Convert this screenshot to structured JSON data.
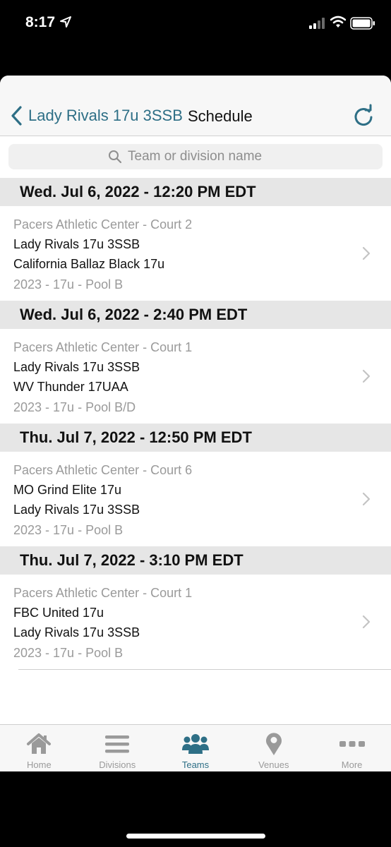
{
  "status_bar": {
    "time": "8:17"
  },
  "nav": {
    "back_label": "Lady Rivals 17u 3SSB",
    "title": "Schedule"
  },
  "search": {
    "placeholder": "Team or division name"
  },
  "games": [
    {
      "datetime": "Wed. Jul 6, 2022 - 12:20 PM EDT",
      "venue": "Pacers Athletic Center - Court 2",
      "team1": "Lady Rivals 17u 3SSB",
      "team2": "California Ballaz Black 17u",
      "division": "2023 - 17u - Pool B"
    },
    {
      "datetime": "Wed. Jul 6, 2022 - 2:40 PM EDT",
      "venue": "Pacers Athletic Center - Court 1",
      "team1": "Lady Rivals 17u 3SSB",
      "team2": "WV Thunder 17UAA",
      "division": "2023 - 17u - Pool B/D"
    },
    {
      "datetime": "Thu. Jul 7, 2022 - 12:50 PM EDT",
      "venue": "Pacers Athletic Center - Court 6",
      "team1": "MO Grind Elite 17u",
      "team2": "Lady Rivals 17u 3SSB",
      "division": "2023 - 17u - Pool B"
    },
    {
      "datetime": "Thu. Jul 7, 2022 - 3:10 PM EDT",
      "venue": "Pacers Athletic Center - Court 1",
      "team1": "FBC United 17u",
      "team2": "Lady Rivals 17u 3SSB",
      "division": "2023 - 17u - Pool B"
    }
  ],
  "tabbar": {
    "tabs": [
      {
        "label": "Home",
        "icon": "home-icon",
        "active": false
      },
      {
        "label": "Divisions",
        "icon": "list-icon",
        "active": false
      },
      {
        "label": "Teams",
        "icon": "teams-icon",
        "active": true
      },
      {
        "label": "Venues",
        "icon": "map-pin-icon",
        "active": false
      },
      {
        "label": "More",
        "icon": "more-icon",
        "active": false
      }
    ]
  },
  "colors": {
    "accent": "#2e6f86",
    "inactive": "#9a9a9a",
    "section_bg": "#e6e6e6"
  }
}
